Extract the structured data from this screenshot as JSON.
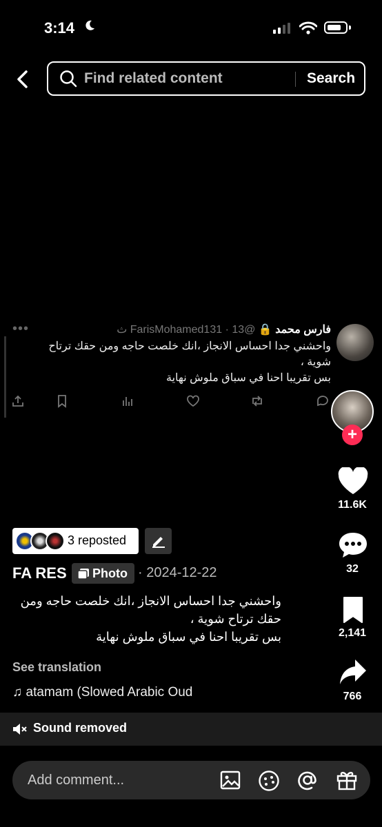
{
  "status": {
    "time": "3:14"
  },
  "search": {
    "placeholder": "Find related content",
    "button": "Search"
  },
  "tweet": {
    "name": "فارس محمد",
    "handle_time": "@FarisMohamed131 · 13 ث",
    "text": "واحشني جدا احساس الانجاز ،انك خلصت حاجه ومن حقك ترتاح شوية ،\nبس تقريبا احنا في سباق ملوش نهاية"
  },
  "rail": {
    "likes": "11.6K",
    "comments": "32",
    "saves": "2,141",
    "shares": "766"
  },
  "post": {
    "reposted": "3 reposted",
    "author": "FA RES",
    "type_label": "Photo",
    "date": "· 2024-12-22",
    "caption": "واحشني جدا احساس الانجاز ،انك خلصت حاجه ومن\nحقك ترتاح شوية ،\nبس تقريبا احنا في سباق ملوش نهاية",
    "see_translation": "See translation",
    "music": "atamam (Slowed Arabic Oud",
    "sound_removed": "Sound removed"
  },
  "comment": {
    "placeholder": "Add comment..."
  },
  "colors": {
    "accent": "#fe2c55",
    "background": "#000000"
  },
  "icons": [
    "moon-icon",
    "signal-icon",
    "wifi-icon",
    "battery-icon",
    "back-arrow-icon",
    "search-icon",
    "share-icon",
    "bookmark-icon",
    "analytics-icon",
    "like-icon",
    "retweet-icon",
    "reply-icon",
    "heart-icon",
    "comment-icon",
    "save-icon",
    "share-arrow-icon",
    "edit-icon",
    "photo-icon",
    "music-note-icon",
    "sound-off-icon",
    "image-icon",
    "emoji-icon",
    "mention-icon",
    "gift-icon"
  ]
}
